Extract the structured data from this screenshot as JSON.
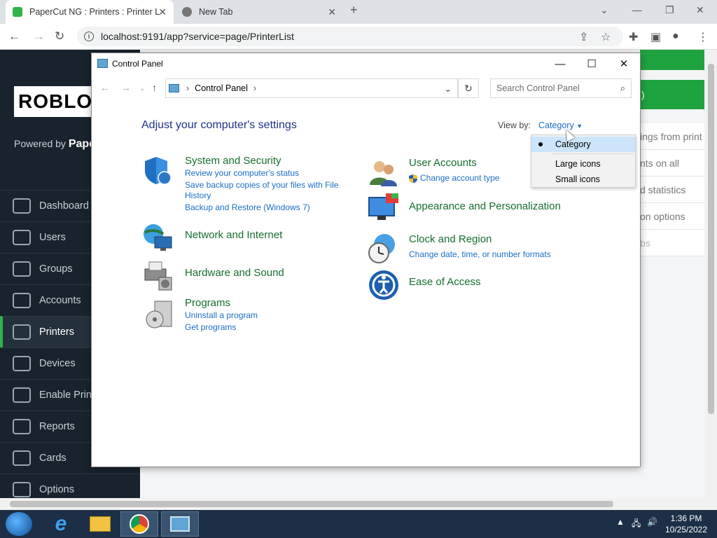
{
  "browser": {
    "tabs": [
      {
        "title": "PaperCut NG : Printers : Printer L"
      },
      {
        "title": "New Tab"
      }
    ],
    "url": "localhost:9191/app?service=page/PrinterList"
  },
  "papercut": {
    "logo_text": "ROBLO",
    "powered_by": "Powered by",
    "powered_brand": "Paper",
    "nav": [
      {
        "label": "Dashboard"
      },
      {
        "label": "Users"
      },
      {
        "label": "Groups"
      },
      {
        "label": "Accounts"
      },
      {
        "label": "Printers"
      },
      {
        "label": "Devices"
      },
      {
        "label": "Enable Print"
      },
      {
        "label": "Reports"
      },
      {
        "label": "Cards"
      },
      {
        "label": "Options"
      }
    ],
    "green_btn": ")",
    "panel_items": [
      {
        "label": "ings from print"
      },
      {
        "label": "nts on all"
      },
      {
        "label": "d statistics"
      },
      {
        "label": "on options"
      },
      {
        "label": "bs"
      }
    ]
  },
  "control_panel": {
    "title": "Control Panel",
    "breadcrumb": "Control Panel",
    "search_placeholder": "Search Control Panel",
    "heading": "Adjust your computer's settings",
    "view_by_label": "View by:",
    "view_by_value": "Category",
    "categories": {
      "system": {
        "title": "System and Security",
        "links": [
          "Review your computer's status",
          "Save backup copies of your files with File",
          "History",
          "Backup and Restore (Windows 7)"
        ]
      },
      "network": {
        "title": "Network and Internet"
      },
      "hardware": {
        "title": "Hardware and Sound"
      },
      "programs": {
        "title": "Programs",
        "links": [
          "Uninstall a program",
          "Get programs"
        ]
      },
      "users": {
        "title": "User Accounts",
        "links": [
          "Change account type"
        ]
      },
      "appearance": {
        "title": "Appearance and Personalization"
      },
      "clock": {
        "title": "Clock and Region",
        "links": [
          "Change date, time, or number formats"
        ]
      },
      "ease": {
        "title": "Ease of Access"
      }
    },
    "view_menu": [
      "Category",
      "Large icons",
      "Small icons"
    ]
  },
  "taskbar": {
    "time": "1:36 PM",
    "date": "10/25/2022"
  }
}
